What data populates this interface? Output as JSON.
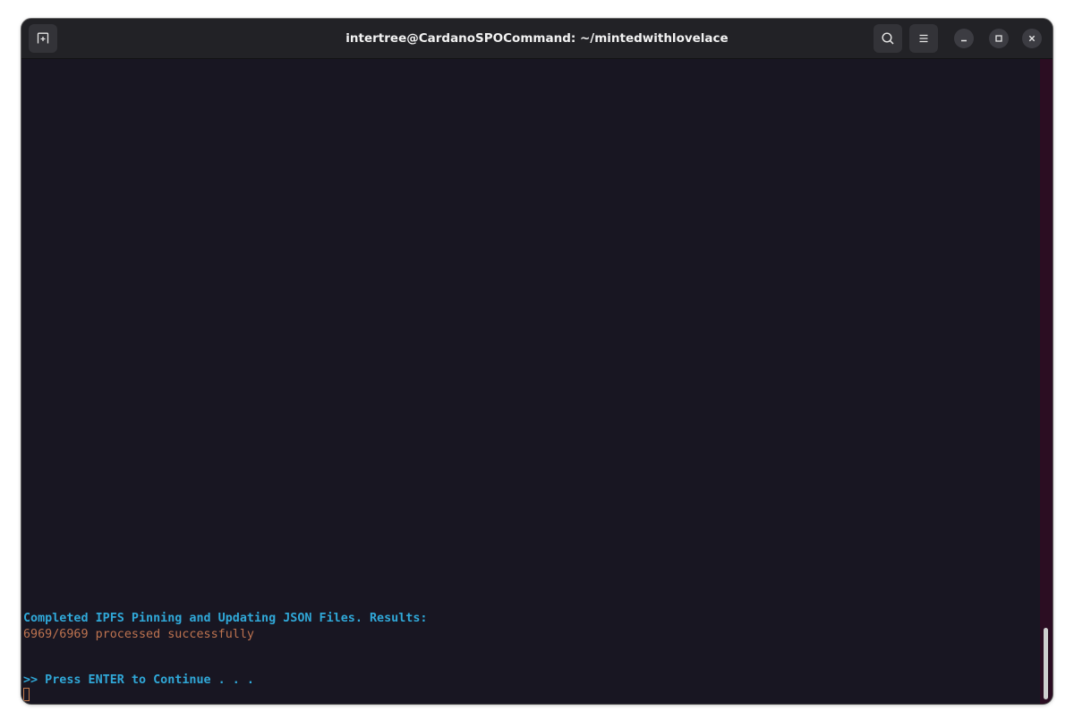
{
  "window": {
    "title": "intertree@CardanoSPOCommand: ~/mintedwithlovelace"
  },
  "icons": {
    "new_tab": "new-tab-icon",
    "search": "search-icon",
    "menu": "hamburger-menu-icon",
    "minimize": "minimize-icon",
    "maximize": "maximize-icon",
    "close": "close-icon"
  },
  "terminal": {
    "lines": [
      "Completed IPFS Pinning and Updating JSON Files. Results:",
      "6969/6969 processed successfully",
      ">> Press ENTER to Continue . . ."
    ]
  },
  "colors": {
    "terminal_bg": "#181622",
    "heading_blue": "#30a8d8",
    "result_orange": "#bd7350",
    "scrollbar_track": "#2b0d22"
  }
}
